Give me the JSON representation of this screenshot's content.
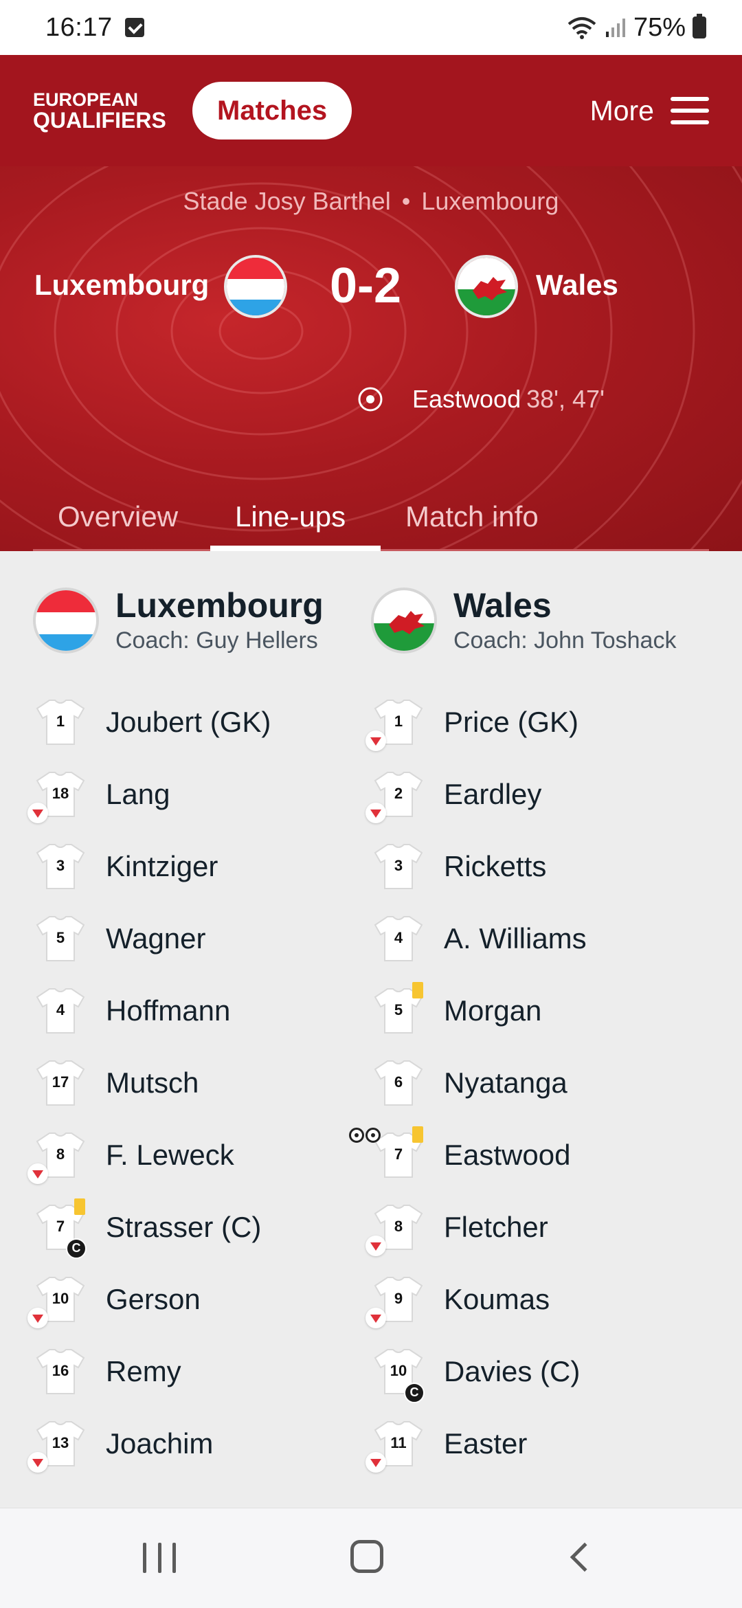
{
  "status_bar": {
    "time": "16:17",
    "battery": "75%",
    "icons": [
      "checkbox-notification-icon",
      "wifi-icon",
      "signal-icon",
      "battery-icon"
    ]
  },
  "header": {
    "logo_line1": "EUROPEAN",
    "logo_line2": "QUALIFIERS",
    "matches_label": "Matches",
    "more_label": "More"
  },
  "match": {
    "stadium": "Stade Josy Barthel",
    "city": "Luxembourg",
    "home_team": "Luxembourg",
    "away_team": "Wales",
    "score": "0-2",
    "scorer_name": "Eastwood",
    "scorer_minutes": "38', 47'"
  },
  "tabs": [
    {
      "label": "Overview",
      "active": false
    },
    {
      "label": "Line-ups",
      "active": true
    },
    {
      "label": "Match info",
      "active": false
    }
  ],
  "lineups": {
    "home": {
      "team": "Luxembourg",
      "coach": "Coach: Guy Hellers",
      "players": [
        {
          "number": "1",
          "name": "Joubert (GK)",
          "subbed_off": false,
          "yellow": false,
          "captain": false
        },
        {
          "number": "18",
          "name": "Lang",
          "subbed_off": true,
          "yellow": false,
          "captain": false
        },
        {
          "number": "3",
          "name": "Kintziger",
          "subbed_off": false,
          "yellow": false,
          "captain": false
        },
        {
          "number": "5",
          "name": "Wagner",
          "subbed_off": false,
          "yellow": false,
          "captain": false
        },
        {
          "number": "4",
          "name": "Hoffmann",
          "subbed_off": false,
          "yellow": false,
          "captain": false
        },
        {
          "number": "17",
          "name": "Mutsch",
          "subbed_off": false,
          "yellow": false,
          "captain": false
        },
        {
          "number": "8",
          "name": "F. Leweck",
          "subbed_off": true,
          "yellow": false,
          "captain": false
        },
        {
          "number": "7",
          "name": "Strasser (C)",
          "subbed_off": false,
          "yellow": true,
          "captain": true
        },
        {
          "number": "10",
          "name": "Gerson",
          "subbed_off": true,
          "yellow": false,
          "captain": false
        },
        {
          "number": "16",
          "name": "Remy",
          "subbed_off": false,
          "yellow": false,
          "captain": false
        },
        {
          "number": "13",
          "name": "Joachim",
          "subbed_off": true,
          "yellow": false,
          "captain": false
        }
      ]
    },
    "away": {
      "team": "Wales",
      "coach": "Coach: John Toshack",
      "players": [
        {
          "number": "1",
          "name": "Price (GK)",
          "subbed_off": true,
          "yellow": false,
          "captain": false
        },
        {
          "number": "2",
          "name": "Eardley",
          "subbed_off": true,
          "yellow": false,
          "captain": false
        },
        {
          "number": "3",
          "name": "Ricketts",
          "subbed_off": false,
          "yellow": false,
          "captain": false
        },
        {
          "number": "4",
          "name": "A. Williams",
          "subbed_off": false,
          "yellow": false,
          "captain": false
        },
        {
          "number": "5",
          "name": "Morgan",
          "subbed_off": false,
          "yellow": true,
          "captain": false
        },
        {
          "number": "6",
          "name": "Nyatanga",
          "subbed_off": false,
          "yellow": false,
          "captain": false
        },
        {
          "number": "7",
          "name": "Eastwood",
          "subbed_off": false,
          "yellow": true,
          "captain": false,
          "goals": 2
        },
        {
          "number": "8",
          "name": "Fletcher",
          "subbed_off": true,
          "yellow": false,
          "captain": false
        },
        {
          "number": "9",
          "name": "Koumas",
          "subbed_off": true,
          "yellow": false,
          "captain": false
        },
        {
          "number": "10",
          "name": "Davies (C)",
          "subbed_off": false,
          "yellow": false,
          "captain": true
        },
        {
          "number": "11",
          "name": "Easter",
          "subbed_off": true,
          "yellow": false,
          "captain": false
        }
      ]
    }
  },
  "captain_badge": "C",
  "colors": {
    "header_red": "#a3151e",
    "yellow_card": "#f7c531",
    "sub_arrow": "#e0313a"
  }
}
